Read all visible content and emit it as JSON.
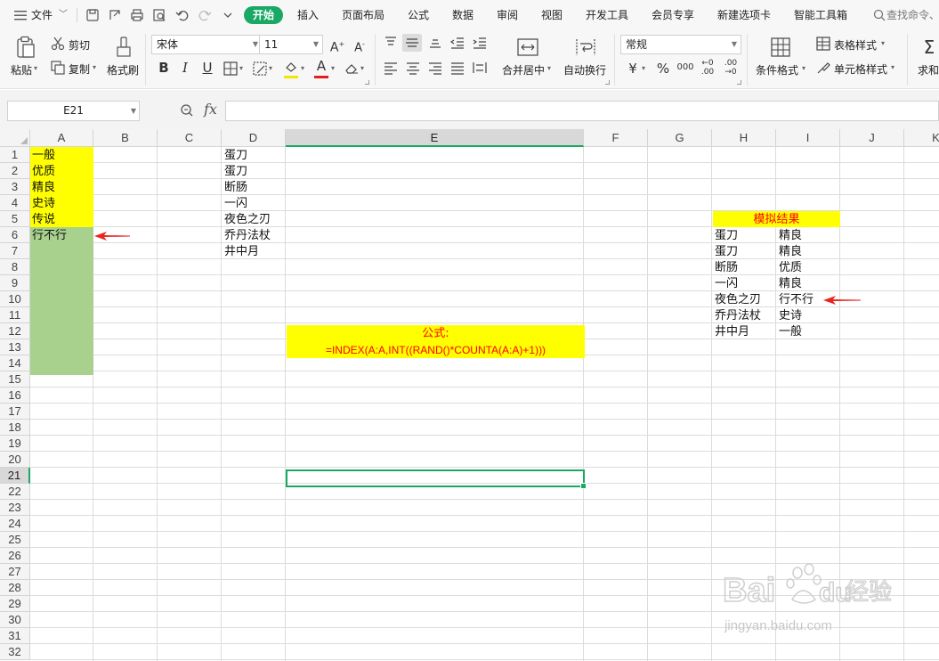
{
  "menubar": {
    "file": "文件",
    "tabs": [
      "开始",
      "插入",
      "页面布局",
      "公式",
      "数据",
      "审阅",
      "视图",
      "开发工具",
      "会员专享",
      "新建选项卡",
      "智能工具箱"
    ],
    "search_placeholder": "查找命令、"
  },
  "ribbon": {
    "paste": "粘贴",
    "cut": "剪切",
    "copy": "复制",
    "format_painter": "格式刷",
    "font_name": "宋体",
    "font_size": "11",
    "merge_center": "合并居中",
    "wrap_text": "自动换行",
    "number_format": "常规",
    "conditional_format": "条件格式",
    "table_style": "表格样式",
    "cell_style": "单元格样式",
    "sum": "求和",
    "colors": {
      "accent": "#1aa865",
      "font_color": "#e0201b",
      "fill_color": "#f3e600"
    }
  },
  "formula_bar": {
    "name_box": "E21",
    "fx": "fx",
    "content": ""
  },
  "columns": [
    "A",
    "B",
    "C",
    "D",
    "E",
    "F",
    "G",
    "H",
    "I",
    "J",
    "K"
  ],
  "rows": [
    "1",
    "2",
    "3",
    "4",
    "5",
    "6",
    "7",
    "8",
    "9",
    "10",
    "11",
    "12",
    "13",
    "14",
    "15",
    "16",
    "17",
    "18",
    "19",
    "20",
    "21",
    "22",
    "23",
    "24",
    "25",
    "26",
    "27",
    "28",
    "29",
    "30",
    "31",
    "32"
  ],
  "sheet": {
    "column_a": [
      "一般",
      "优质",
      "精良",
      "史诗",
      "传说",
      "行不行"
    ],
    "column_d": [
      "蛋刀",
      "蛋刀",
      "断肠",
      "一闪",
      "夜色之刃",
      "乔丹法杖",
      "井中月"
    ],
    "formula_label": "公式:",
    "formula_text": "=INDEX(A:A,INT((RAND()*COUNTA(A:A)+1)))",
    "result_title": "模拟结果",
    "results": [
      {
        "item": "蛋刀",
        "grade": "精良"
      },
      {
        "item": "蛋刀",
        "grade": "精良"
      },
      {
        "item": "断肠",
        "grade": "优质"
      },
      {
        "item": "一闪",
        "grade": "精良"
      },
      {
        "item": "夜色之刃",
        "grade": "行不行"
      },
      {
        "item": "乔丹法杖",
        "grade": "史诗"
      },
      {
        "item": "井中月",
        "grade": "一般"
      }
    ],
    "colors": {
      "yellow": "#ffff00",
      "green": "#a9d18e",
      "red_text": "#ff0000",
      "arrow": "#e8251f"
    }
  },
  "watermark": {
    "text1": "Bai",
    "text2": "du",
    "text3": "经验",
    "url": "jingyan.baidu.com"
  }
}
